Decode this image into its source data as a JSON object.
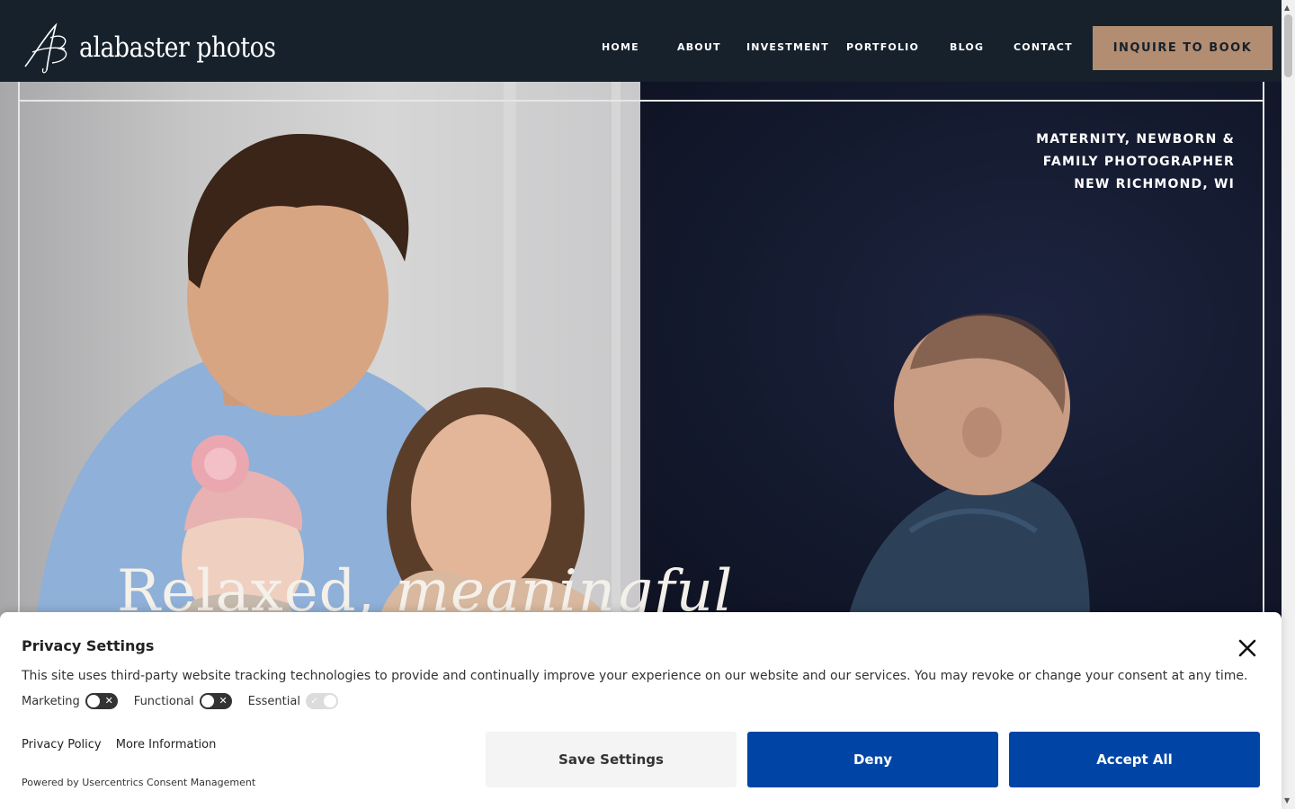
{
  "stray_char": ">",
  "header": {
    "logo_text": "alabaster photos",
    "nav": [
      {
        "label": "HOME"
      },
      {
        "label": "ABOUT"
      },
      {
        "label": "INVESTMENT"
      },
      {
        "label": "PORTFOLIO"
      },
      {
        "label": "BLOG"
      },
      {
        "label": "CONTACT"
      }
    ],
    "cta_label": "INQUIRE TO BOOK"
  },
  "hero": {
    "tagline": [
      "MATERNITY, NEWBORN &",
      "FAMILY PHOTOGRAPHER",
      "NEW RICHMOND, WI"
    ],
    "heading_plain": "Relaxed, ",
    "heading_italic": "meaningful"
  },
  "consent": {
    "title": "Privacy Settings",
    "description": "This site uses third-party website tracking technologies to provide and continually improve your experience on our website and our services. You may revoke or change your consent at any time.",
    "toggles": [
      {
        "label": "Marketing",
        "enabled": false
      },
      {
        "label": "Functional",
        "enabled": false
      },
      {
        "label": "Essential",
        "enabled": true,
        "locked": true
      }
    ],
    "links": {
      "privacy_policy": "Privacy Policy",
      "more_info": "More Information"
    },
    "powered_by": "Powered by Usercentrics Consent Management",
    "buttons": {
      "save": "Save Settings",
      "deny": "Deny",
      "accept": "Accept All"
    }
  },
  "colors": {
    "header_bg": "#16212c",
    "cta_bg": "#b38d71",
    "primary_button": "#0045a5"
  }
}
